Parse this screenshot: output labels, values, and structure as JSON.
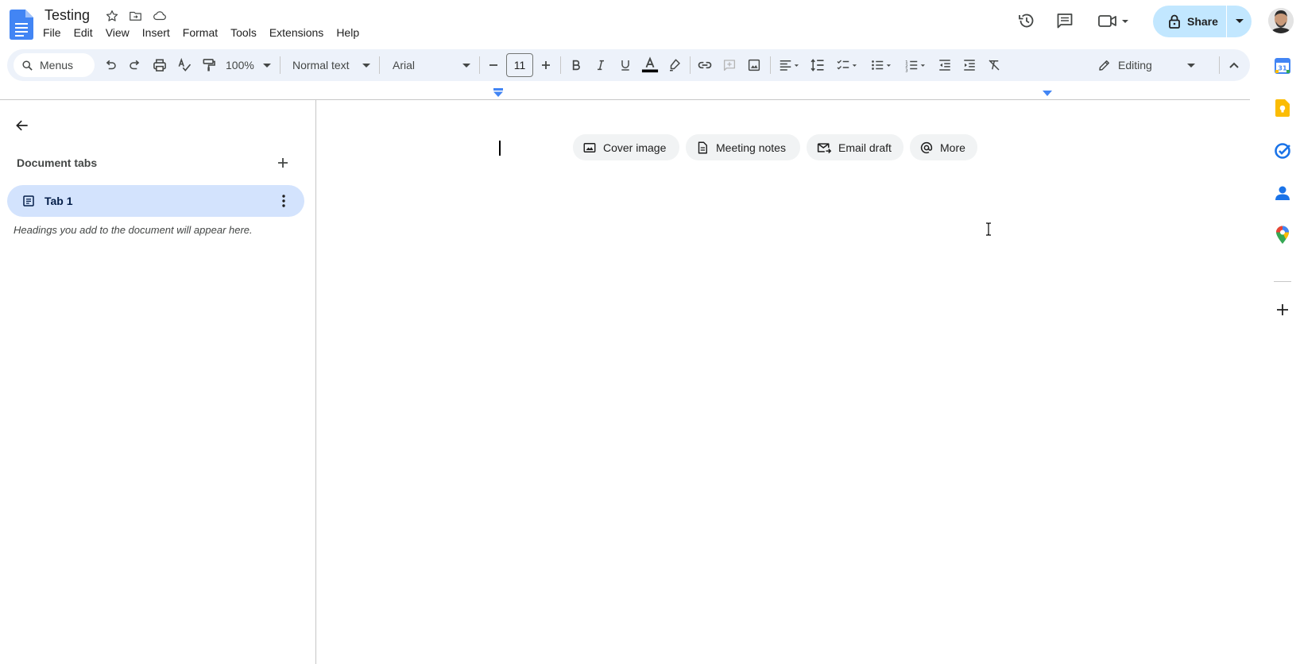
{
  "document": {
    "title": "Testing"
  },
  "menubar": {
    "items": [
      "File",
      "Edit",
      "View",
      "Insert",
      "Format",
      "Tools",
      "Extensions",
      "Help"
    ]
  },
  "header_actions": {
    "share_label": "Share"
  },
  "toolbar": {
    "search_label": "Menus",
    "zoom": "100%",
    "paragraph_style": "Normal text",
    "font_family": "Arial",
    "font_size": "11",
    "editing_mode": "Editing"
  },
  "left_panel": {
    "heading": "Document tabs",
    "tabs": [
      {
        "label": "Tab 1"
      }
    ],
    "hint": "Headings you add to the document will appear here."
  },
  "chips": [
    {
      "label": "Cover image",
      "icon": "image-icon"
    },
    {
      "label": "Meeting notes",
      "icon": "document-icon"
    },
    {
      "label": "Email draft",
      "icon": "email-icon"
    },
    {
      "label": "More",
      "icon": "at-sign-icon"
    }
  ],
  "side_panel": {
    "apps": [
      "calendar-icon",
      "keep-icon",
      "tasks-icon",
      "contacts-icon",
      "maps-icon"
    ]
  },
  "colors": {
    "toolbar_bg": "#edf2fa",
    "share_bg": "#c2e7ff",
    "active_tab_bg": "#d3e3fd",
    "chip_bg": "#f1f3f4",
    "docs_blue": "#4285f4"
  }
}
